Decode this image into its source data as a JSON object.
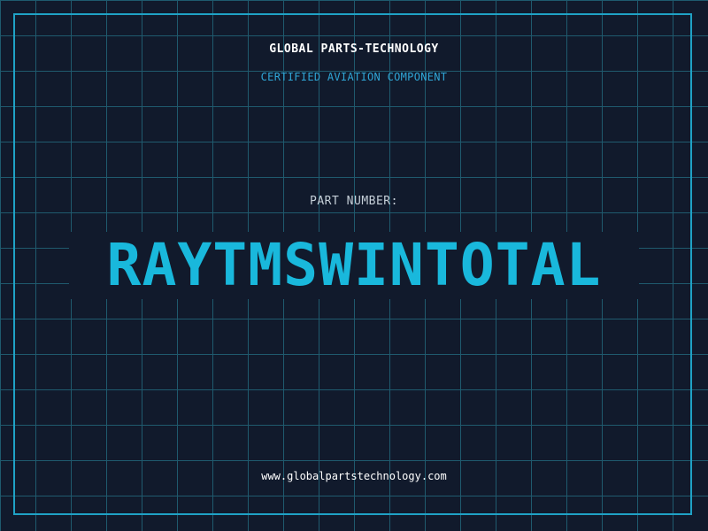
{
  "header": {
    "company": "GLOBAL PARTS-TECHNOLOGY",
    "subtitle": "CERTIFIED AVIATION COMPONENT"
  },
  "part": {
    "label": "PART NUMBER:",
    "number": "RAYTMSWINTOTAL"
  },
  "footer": {
    "website": "www.globalpartstechnology.com"
  },
  "colors": {
    "background": "#111a2c",
    "grid": "#1f5a6e",
    "accent": "#19b8dc",
    "frame": "#1fa2c6"
  }
}
